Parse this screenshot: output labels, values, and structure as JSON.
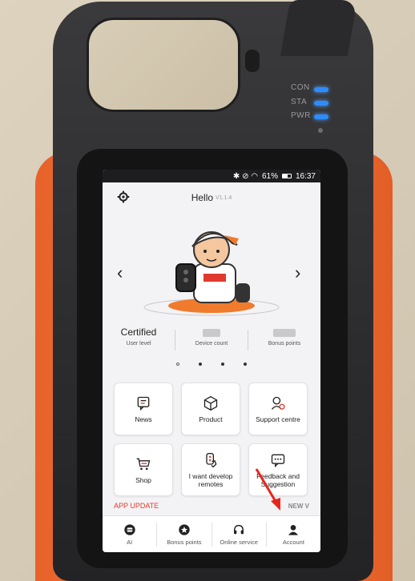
{
  "status_bar": {
    "indicators": "✱ ⊘ ◠",
    "battery": "61%",
    "time": "16:37"
  },
  "device_leds": [
    {
      "label": "CON",
      "color": "#2f8cff"
    },
    {
      "label": "STA",
      "color": "#2f8cff"
    },
    {
      "label": "PWR",
      "color": "#2f8cff"
    }
  ],
  "header": {
    "title": "Hello",
    "version": "V1.1.4",
    "settings_icon": "gear-icon"
  },
  "carousel": {
    "prev_icon": "chevron-left-icon",
    "next_icon": "chevron-right-icon",
    "pages": 4,
    "active_page": 2
  },
  "stats": [
    {
      "value": "Certified",
      "label": "User level"
    },
    {
      "value": "",
      "label": "Device count"
    },
    {
      "value": "",
      "label": "Bonus points"
    }
  ],
  "tiles": [
    {
      "label": "News",
      "icon": "news-icon"
    },
    {
      "label": "Product",
      "icon": "box-icon"
    },
    {
      "label": "Support centre",
      "icon": "support-icon"
    },
    {
      "label": "Shop",
      "icon": "cart-icon"
    },
    {
      "label": "I want develop remotes",
      "icon": "remote-hand-icon"
    },
    {
      "label": "Feedback and Suggestion",
      "icon": "chat-icon"
    }
  ],
  "update": {
    "left": "APP UPDATE",
    "right": "NEW V"
  },
  "tabbar": [
    {
      "label": "AI",
      "icon": "ai-icon"
    },
    {
      "label": "Bonus points",
      "icon": "star-icon"
    },
    {
      "label": "Online service",
      "icon": "headset-icon"
    },
    {
      "label": "Account",
      "icon": "person-icon"
    }
  ],
  "colors": {
    "accent_red": "#e03a2e",
    "led_blue": "#2f8cff",
    "bumper_orange": "#f27a3a"
  }
}
